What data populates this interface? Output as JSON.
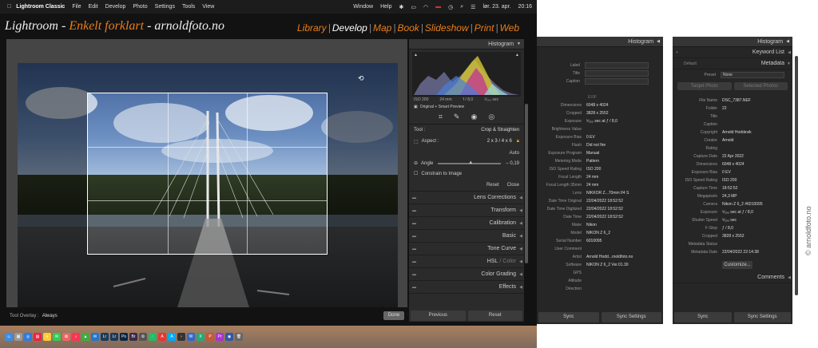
{
  "menubar": {
    "app": "Lightroom Classic",
    "items": [
      "File",
      "Edit",
      "Develop",
      "Photo",
      "Settings",
      "Tools",
      "View"
    ],
    "right": {
      "window": "Window",
      "help": "Help",
      "date": "lør. 23. apr.",
      "time": "20:16"
    }
  },
  "identity": {
    "part1": "Lightroom - ",
    "part2": "Enkelt forklart",
    "part3": " - arnoldfoto.no"
  },
  "modules": [
    "Library",
    "Develop",
    "Map",
    "Book",
    "Slideshow",
    "Print",
    "Web"
  ],
  "active_module": "Develop",
  "toolbar": {
    "overlay_label": "Tool Overlay :",
    "overlay_value": "Always",
    "done": "Done"
  },
  "right_panel": {
    "histogram_title": "Histogram",
    "hist_info": [
      "ISO 200",
      "24 mm",
      "f / 8,0",
      "⅟₂₅₀ sec"
    ],
    "preview_label": "Original + Smart Preview",
    "tool_label": "Tool :",
    "tool_value": "Crop & Straighten",
    "aspect_label": "Aspect :",
    "aspect_value": "2 x 3  /  4 x 6",
    "auto": "Auto",
    "angle_label": "Angle",
    "angle_value": "– 0,19",
    "constrain": "Constrain to Image",
    "reset": "Reset",
    "close": "Close",
    "sections": [
      "Lens Corrections",
      "Transform",
      "Calibration",
      "Basic",
      "Tone Curve",
      "Color Grading",
      "Effects"
    ],
    "hsl": "HSL",
    "hsl_color": "Color",
    "previous": "Previous",
    "reset_btn": "Reset"
  },
  "exif_panel": {
    "title": "Histogram",
    "top_rows": [
      {
        "k": "Label",
        "v": ""
      },
      {
        "k": "Title",
        "v": ""
      },
      {
        "k": "Caption",
        "v": ""
      }
    ],
    "exif_header": "EXIF",
    "rows": [
      {
        "k": "Dimensions",
        "v": "6048 x 4024"
      },
      {
        "k": "Cropped",
        "v": "3828 x 2552"
      },
      {
        "k": "Exposure",
        "v": "⅟₂₅₀ sec at ƒ / 8,0"
      },
      {
        "k": "Brightness Value",
        "v": ""
      },
      {
        "k": "Exposure Bias",
        "v": "0 EV"
      },
      {
        "k": "Flash",
        "v": "Did not fire"
      },
      {
        "k": "Exposure Program",
        "v": "Manual"
      },
      {
        "k": "Metering Mode",
        "v": "Pattern"
      },
      {
        "k": "ISO Speed Rating",
        "v": "ISO 200"
      },
      {
        "k": "Focal Length",
        "v": "24 mm"
      },
      {
        "k": "Focal Length 35mm",
        "v": "24 mm"
      },
      {
        "k": "Lens",
        "v": "NIKKOR Z...70mm f/4 S"
      },
      {
        "k": "Date Time Original",
        "v": "22/04/2022 18:52:52"
      },
      {
        "k": "Date Time Digitized",
        "v": "22/04/2022 18:52:52"
      },
      {
        "k": "Date Time",
        "v": "22/04/2022 18:52:52"
      },
      {
        "k": "Make",
        "v": "Nikon"
      },
      {
        "k": "Model",
        "v": "NIKON Z 6_2"
      },
      {
        "k": "Serial Number",
        "v": "6010095"
      },
      {
        "k": "User Comment",
        "v": ""
      },
      {
        "k": "Artist",
        "v": "Arnold Hodd...rnoldfoto.no"
      },
      {
        "k": "Software",
        "v": "NIKON Z 6_2 Ver.01.30"
      },
      {
        "k": "GPS",
        "v": ""
      },
      {
        "k": "Altitude",
        "v": ""
      },
      {
        "k": "Direction",
        "v": ""
      }
    ],
    "sync": "Sync",
    "sync_settings": "Sync Settings"
  },
  "meta_panel": {
    "title": "Histogram",
    "keyword_list": "Keyword List",
    "metadata": "Metadata",
    "default": "Default",
    "preset_label": "Preset",
    "preset_value": "None",
    "target_photo": "Target Photo",
    "selected_photos": "Selected Photos",
    "rows": [
      {
        "k": "File Name",
        "v": "DSC_7387.NEF"
      },
      {
        "k": "Folder",
        "v": "22"
      },
      {
        "k": "Title",
        "v": ""
      },
      {
        "k": "Caption",
        "v": ""
      },
      {
        "k": "Copyright",
        "v": "Arnold Hoddevik"
      },
      {
        "k": "Creator",
        "v": "Arnold"
      },
      {
        "k": "Rating",
        "v": ""
      },
      {
        "k": "Capture Date",
        "v": "22 Apr 2022"
      },
      {
        "k": "Dimensions",
        "v": "6048 x 4024"
      },
      {
        "k": "Exposure Bias",
        "v": "0 EV"
      },
      {
        "k": "ISO Speed Rating",
        "v": "ISO 200"
      },
      {
        "k": "Capture Time",
        "v": "18:52:52"
      },
      {
        "k": "Megapixels",
        "v": "24,3 MP"
      },
      {
        "k": "Camera",
        "v": "Nikon Z 6_2 #6010095"
      },
      {
        "k": "Exposure",
        "v": "⅟₂₅₀ sec at ƒ / 8,0"
      },
      {
        "k": "Shutter Speed",
        "v": "⅟₂₅₀ sec"
      },
      {
        "k": "F-Stop",
        "v": "ƒ / 8,0"
      },
      {
        "k": "Cropped",
        "v": "3828 x 2552"
      },
      {
        "k": "Metadata Status",
        "v": ""
      },
      {
        "k": "Metadata Date",
        "v": "22/04/2022 22:14:38"
      }
    ],
    "customize": "Customize...",
    "comments": "Comments",
    "sync": "Sync",
    "sync_settings": "Sync Settings"
  },
  "watermark": "© arnoldfoto.no"
}
